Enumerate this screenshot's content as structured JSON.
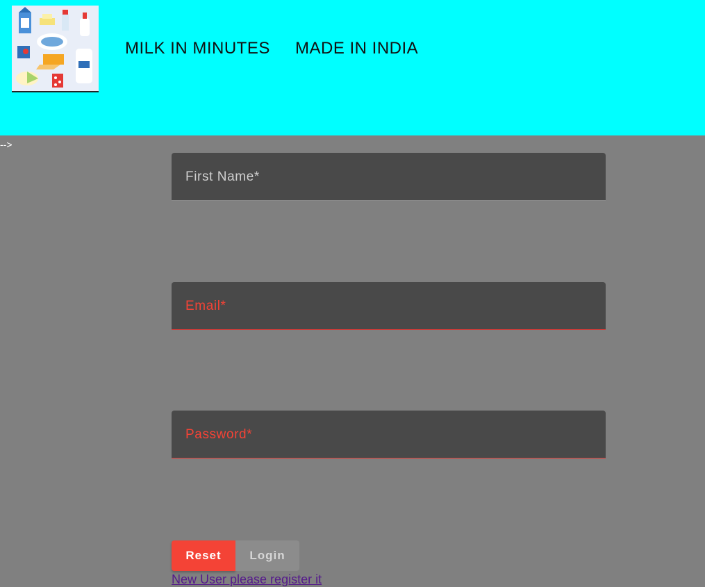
{
  "header": {
    "background": "#00ffff",
    "logo_icon": "milk-products-logo-icon",
    "nav": [
      "MILK IN MINUTES",
      "MADE IN INDIA"
    ]
  },
  "stray_text": "-->",
  "form": {
    "fields": [
      {
        "label": "First Name*",
        "value": ""
      },
      {
        "label": "Email*",
        "value": ""
      },
      {
        "label": "Password*",
        "value": ""
      }
    ],
    "buttons": {
      "reset": "Reset",
      "login": "Login"
    },
    "register_link": "New User please register it"
  },
  "colors": {
    "page_background": "#808080",
    "field_background": "#494949",
    "error": "#f44336",
    "link": "#551a8b"
  }
}
